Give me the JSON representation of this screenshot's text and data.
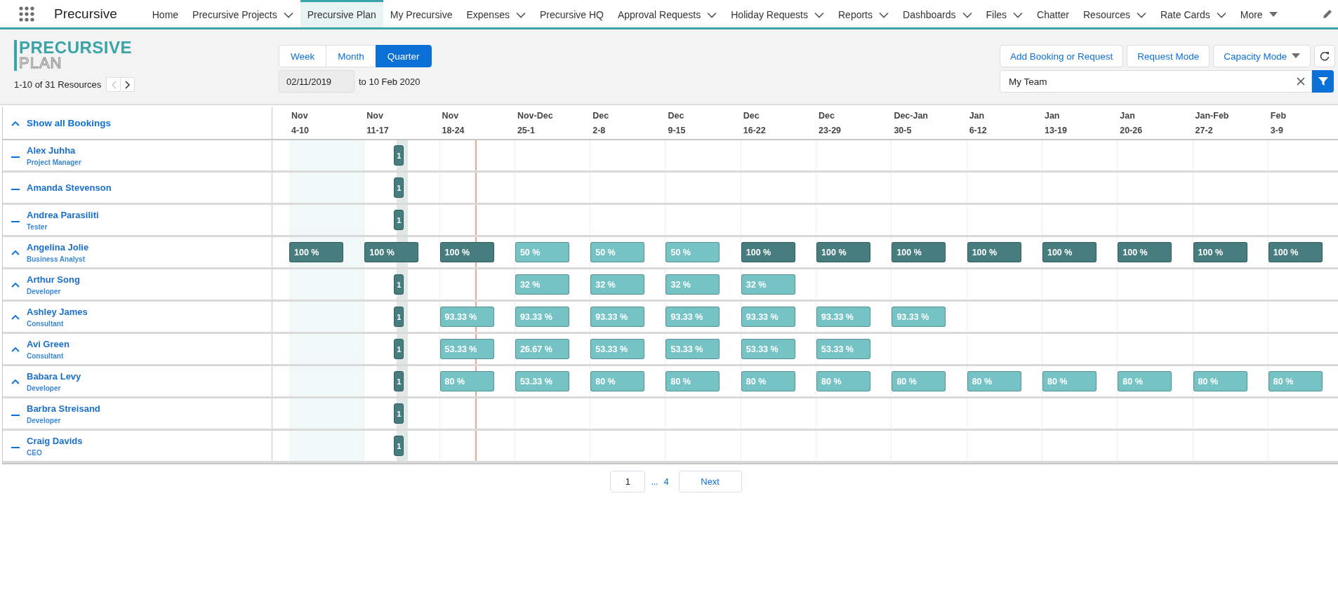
{
  "app": {
    "name": "Precursive"
  },
  "nav_tabs": [
    {
      "label": "Home",
      "selected": false,
      "dropdown": false
    },
    {
      "label": "Precursive Projects",
      "selected": false,
      "dropdown": true
    },
    {
      "label": "Precursive Plan",
      "selected": true,
      "dropdown": false
    },
    {
      "label": "My Precursive",
      "selected": false,
      "dropdown": false
    },
    {
      "label": "Expenses",
      "selected": false,
      "dropdown": true
    },
    {
      "label": "Precursive HQ",
      "selected": false,
      "dropdown": false
    },
    {
      "label": "Approval Requests",
      "selected": false,
      "dropdown": true
    },
    {
      "label": "Holiday Requests",
      "selected": false,
      "dropdown": true
    },
    {
      "label": "Reports",
      "selected": false,
      "dropdown": true
    },
    {
      "label": "Dashboards",
      "selected": false,
      "dropdown": true
    },
    {
      "label": "Files",
      "selected": false,
      "dropdown": true
    },
    {
      "label": "Chatter",
      "selected": false,
      "dropdown": false
    },
    {
      "label": "Resources",
      "selected": false,
      "dropdown": true
    },
    {
      "label": "Rate Cards",
      "selected": false,
      "dropdown": true
    }
  ],
  "more_tab": {
    "label": "More"
  },
  "header": {
    "logo": {
      "line_1": "PRECURSIVE",
      "line_2": "PLAN"
    },
    "resource_count": "1-10 of 31 Resources",
    "pager": {
      "previous_disabled": true,
      "next_disabled": false
    },
    "views": [
      {
        "label": "Week",
        "selected": false
      },
      {
        "label": "Month",
        "selected": false
      },
      {
        "label": "Quarter",
        "selected": true
      }
    ],
    "start_date": "02/11/2019",
    "end_date": "to 10 Feb 2020",
    "actions": [
      {
        "label": "Add Booking or Request",
        "dropdown": false
      },
      {
        "label": "Request Mode",
        "dropdown": false
      },
      {
        "label": "Capacity Mode",
        "dropdown": true
      }
    ],
    "filter": {
      "value": "My Team"
    }
  },
  "schedule": {
    "toggle_label": "Show all Bookings",
    "weeks": [
      {
        "month": "Nov",
        "days": "4-10",
        "highlighted": true
      },
      {
        "month": "Nov",
        "days": "11-17",
        "highlighted": false
      },
      {
        "month": "Nov",
        "days": "18-24",
        "highlighted": false
      },
      {
        "month": "Nov-Dec",
        "days": "25-1",
        "highlighted": false
      },
      {
        "month": "Dec",
        "days": "2-8",
        "highlighted": false
      },
      {
        "month": "Dec",
        "days": "9-15",
        "highlighted": false
      },
      {
        "month": "Dec",
        "days": "16-22",
        "highlighted": false
      },
      {
        "month": "Dec",
        "days": "23-29",
        "highlighted": false
      },
      {
        "month": "Dec-Jan",
        "days": "30-5",
        "highlighted": false
      },
      {
        "month": "Jan",
        "days": "6-12",
        "highlighted": false
      },
      {
        "month": "Jan",
        "days": "13-19",
        "highlighted": false
      },
      {
        "month": "Jan",
        "days": "20-26",
        "highlighted": false
      },
      {
        "month": "Jan-Feb",
        "days": "27-2",
        "highlighted": false
      },
      {
        "month": "Feb",
        "days": "3-9",
        "highlighted": false
      }
    ],
    "resources": [
      {
        "name": "Alex Juhha",
        "role": "Project Manager",
        "expanded": false,
        "marker": "1",
        "bookings": [
          {
            "kind": "empty"
          },
          {
            "kind": "empty"
          },
          {
            "kind": "empty"
          },
          {
            "kind": "empty"
          },
          {
            "kind": "empty"
          },
          {
            "kind": "empty"
          },
          {
            "kind": "empty"
          },
          {
            "kind": "empty"
          },
          {
            "kind": "empty"
          },
          {
            "kind": "empty"
          },
          {
            "kind": "empty"
          },
          {
            "kind": "empty"
          },
          {
            "kind": "empty"
          },
          {
            "kind": "empty"
          }
        ]
      },
      {
        "name": "Amanda Stevenson",
        "expanded": false,
        "marker": "1",
        "bookings": [
          {
            "kind": "empty"
          },
          {
            "kind": "empty"
          },
          {
            "kind": "empty"
          },
          {
            "kind": "empty"
          },
          {
            "kind": "empty"
          },
          {
            "kind": "empty"
          },
          {
            "kind": "empty"
          },
          {
            "kind": "empty"
          },
          {
            "kind": "empty"
          },
          {
            "kind": "empty"
          },
          {
            "kind": "empty"
          },
          {
            "kind": "empty"
          },
          {
            "kind": "empty"
          },
          {
            "kind": "empty"
          }
        ]
      },
      {
        "name": "Andrea Parasiliti",
        "role": "Tester",
        "expanded": false,
        "marker": "1",
        "bookings": [
          {
            "kind": "empty"
          },
          {
            "kind": "empty"
          },
          {
            "kind": "empty"
          },
          {
            "kind": "empty"
          },
          {
            "kind": "empty"
          },
          {
            "kind": "empty"
          },
          {
            "kind": "empty"
          },
          {
            "kind": "empty"
          },
          {
            "kind": "empty"
          },
          {
            "kind": "empty"
          },
          {
            "kind": "empty"
          },
          {
            "kind": "empty"
          },
          {
            "kind": "empty"
          },
          {
            "kind": "empty"
          }
        ]
      },
      {
        "name": "Angelina Jolie",
        "role": "Business Analyst",
        "expanded": true,
        "bookings": [
          {
            "kind": "booking",
            "label": "100 %",
            "color": "#477d7e"
          },
          {
            "kind": "booking",
            "label": "100 %",
            "color": "#477d7e"
          },
          {
            "kind": "booking",
            "label": "100 %",
            "color": "#477d7e"
          },
          {
            "kind": "booking",
            "label": "50 %",
            "color": "#76c3c6"
          },
          {
            "kind": "booking",
            "label": "50 %",
            "color": "#76c3c6"
          },
          {
            "kind": "booking",
            "label": "50 %",
            "color": "#76c3c6"
          },
          {
            "kind": "booking",
            "label": "100 %",
            "color": "#477d7e"
          },
          {
            "kind": "booking",
            "label": "100 %",
            "color": "#477d7e"
          },
          {
            "kind": "booking",
            "label": "100 %",
            "color": "#477d7e"
          },
          {
            "kind": "booking",
            "label": "100 %",
            "color": "#477d7e"
          },
          {
            "kind": "booking",
            "label": "100 %",
            "color": "#477d7e"
          },
          {
            "kind": "booking",
            "label": "100 %",
            "color": "#477d7e"
          },
          {
            "kind": "booking",
            "label": "100 %",
            "color": "#477d7e"
          },
          {
            "kind": "booking",
            "label": "100 %",
            "color": "#477d7e"
          }
        ]
      },
      {
        "name": "Arthur Song",
        "role": "Developer",
        "expanded": true,
        "marker": "1",
        "bookings": [
          {
            "kind": "empty"
          },
          {
            "kind": "empty"
          },
          {
            "kind": "empty"
          },
          {
            "kind": "booking",
            "label": "32 %",
            "color": "#76c3c6"
          },
          {
            "kind": "booking",
            "label": "32 %",
            "color": "#76c3c6"
          },
          {
            "kind": "booking",
            "label": "32 %",
            "color": "#76c3c6"
          },
          {
            "kind": "booking",
            "label": "32 %",
            "color": "#76c3c6"
          },
          {
            "kind": "empty"
          },
          {
            "kind": "empty"
          },
          {
            "kind": "empty"
          },
          {
            "kind": "empty"
          },
          {
            "kind": "empty"
          },
          {
            "kind": "empty"
          },
          {
            "kind": "empty"
          }
        ]
      },
      {
        "name": "Ashley James",
        "role": "Consultant",
        "expanded": true,
        "marker": "1",
        "bookings": [
          {
            "kind": "empty"
          },
          {
            "kind": "empty"
          },
          {
            "kind": "booking",
            "label": "93.33 %",
            "color": "#76c3c6"
          },
          {
            "kind": "booking",
            "label": "93.33 %",
            "color": "#76c3c6"
          },
          {
            "kind": "booking",
            "label": "93.33 %",
            "color": "#76c3c6"
          },
          {
            "kind": "booking",
            "label": "93.33 %",
            "color": "#76c3c6"
          },
          {
            "kind": "booking",
            "label": "93.33 %",
            "color": "#76c3c6"
          },
          {
            "kind": "booking",
            "label": "93.33 %",
            "color": "#76c3c6"
          },
          {
            "kind": "booking",
            "label": "93.33 %",
            "color": "#76c3c6"
          },
          {
            "kind": "empty"
          },
          {
            "kind": "empty"
          },
          {
            "kind": "empty"
          },
          {
            "kind": "empty"
          },
          {
            "kind": "empty"
          }
        ]
      },
      {
        "name": "Avi Green",
        "role": "Consultant",
        "expanded": true,
        "marker": "1",
        "bookings": [
          {
            "kind": "empty"
          },
          {
            "kind": "empty"
          },
          {
            "kind": "booking",
            "label": "53.33 %",
            "color": "#76c3c6"
          },
          {
            "kind": "booking",
            "label": "26.67 %",
            "color": "#76c3c6"
          },
          {
            "kind": "booking",
            "label": "53.33 %",
            "color": "#76c3c6"
          },
          {
            "kind": "booking",
            "label": "53.33 %",
            "color": "#76c3c6"
          },
          {
            "kind": "booking",
            "label": "53.33 %",
            "color": "#76c3c6"
          },
          {
            "kind": "booking",
            "label": "53.33 %",
            "color": "#76c3c6"
          },
          {
            "kind": "empty"
          },
          {
            "kind": "empty"
          },
          {
            "kind": "empty"
          },
          {
            "kind": "empty"
          },
          {
            "kind": "empty"
          },
          {
            "kind": "empty"
          }
        ]
      },
      {
        "name": "Babara Levy",
        "role": "Developer",
        "expanded": true,
        "marker": "1",
        "bookings": [
          {
            "kind": "empty"
          },
          {
            "kind": "empty"
          },
          {
            "kind": "booking",
            "label": "80 %",
            "color": "#76c3c6"
          },
          {
            "kind": "booking",
            "label": "53.33 %",
            "color": "#76c3c6"
          },
          {
            "kind": "booking",
            "label": "80 %",
            "color": "#76c3c6"
          },
          {
            "kind": "booking",
            "label": "80 %",
            "color": "#76c3c6"
          },
          {
            "kind": "booking",
            "label": "80 %",
            "color": "#76c3c6"
          },
          {
            "kind": "booking",
            "label": "80 %",
            "color": "#76c3c6"
          },
          {
            "kind": "booking",
            "label": "80 %",
            "color": "#76c3c6"
          },
          {
            "kind": "booking",
            "label": "80 %",
            "color": "#76c3c6"
          },
          {
            "kind": "booking",
            "label": "80 %",
            "color": "#76c3c6"
          },
          {
            "kind": "booking",
            "label": "80 %",
            "color": "#76c3c6"
          },
          {
            "kind": "booking",
            "label": "80 %",
            "color": "#76c3c6"
          },
          {
            "kind": "booking",
            "label": "80 %",
            "color": "#76c3c6"
          }
        ]
      },
      {
        "name": "Barbra Streisand",
        "role": "Developer",
        "expanded": false,
        "marker": "1",
        "bookings": [
          {
            "kind": "empty"
          },
          {
            "kind": "empty"
          },
          {
            "kind": "empty"
          },
          {
            "kind": "empty"
          },
          {
            "kind": "empty"
          },
          {
            "kind": "empty"
          },
          {
            "kind": "empty"
          },
          {
            "kind": "empty"
          },
          {
            "kind": "empty"
          },
          {
            "kind": "empty"
          },
          {
            "kind": "empty"
          },
          {
            "kind": "empty"
          },
          {
            "kind": "empty"
          },
          {
            "kind": "empty"
          }
        ]
      },
      {
        "name": "Craig Davids",
        "role": "CEO",
        "expanded": false,
        "marker": "1",
        "bookings": [
          {
            "kind": "empty"
          },
          {
            "kind": "empty"
          },
          {
            "kind": "empty"
          },
          {
            "kind": "empty"
          },
          {
            "kind": "empty"
          },
          {
            "kind": "empty"
          },
          {
            "kind": "empty"
          },
          {
            "kind": "empty"
          },
          {
            "kind": "empty"
          },
          {
            "kind": "empty"
          },
          {
            "kind": "empty"
          },
          {
            "kind": "empty"
          },
          {
            "kind": "empty"
          },
          {
            "kind": "empty"
          }
        ]
      }
    ]
  },
  "pagination": {
    "current": "1",
    "ellipsis": "...",
    "last": "4",
    "next": "Next"
  }
}
